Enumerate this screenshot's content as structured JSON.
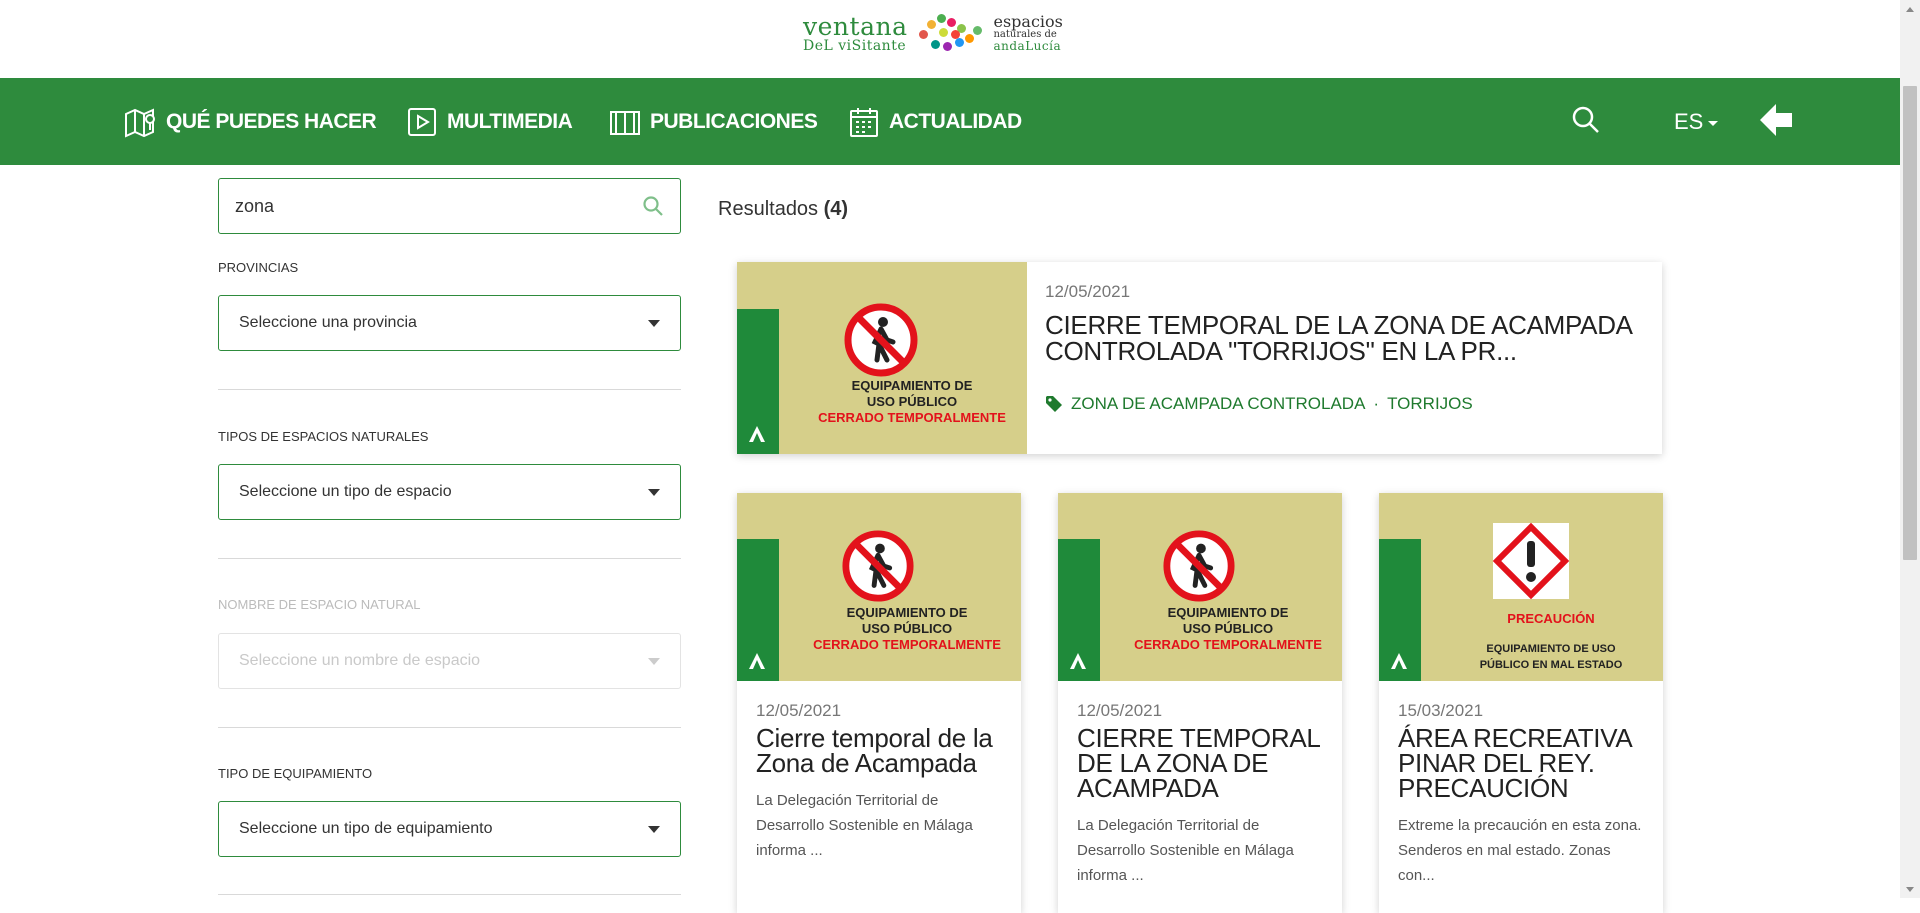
{
  "header": {
    "logo": {
      "brand_line1": "ventana",
      "brand_line2": "DeL viSitante",
      "partner_line1": "espacios",
      "partner_line2": "naturales de",
      "partner_line3": "andaLucía"
    },
    "nav": [
      {
        "label": "QUÉ PUEDES HACER",
        "icon": "map-pin-icon"
      },
      {
        "label": "MULTIMEDIA",
        "icon": "play-icon"
      },
      {
        "label": "PUBLICACIONES",
        "icon": "book-icon"
      },
      {
        "label": "ACTUALIDAD",
        "icon": "calendar-icon"
      }
    ],
    "language": "ES"
  },
  "sidebar": {
    "search": {
      "value": "zona"
    },
    "filters": [
      {
        "label": "PROVINCIAS",
        "selected": "Seleccione una provincia",
        "disabled": false
      },
      {
        "label": "TIPOS DE ESPACIOS NATURALES",
        "selected": "Seleccione un tipo de espacio",
        "disabled": false
      },
      {
        "label": "NOMBRE DE ESPACIO NATURAL",
        "selected": "Seleccione un nombre de espacio",
        "disabled": true
      },
      {
        "label": "TIPO DE EQUIPAMIENTO",
        "selected": "Seleccione un tipo de equipamiento",
        "disabled": false
      }
    ]
  },
  "results": {
    "label": "Resultados",
    "count": "(4)",
    "featured": {
      "date": "12/05/2021",
      "title": "CIERRE TEMPORAL DE LA ZONA DE ACAMPADA CONTROLADA \"TORRIJOS\" EN LA PR...",
      "tags": [
        "ZONA DE ACAMPADA CONTROLADA",
        "TORRIJOS"
      ],
      "tag_separator": "·",
      "thumb": {
        "line1": "EQUIPAMIENTO DE",
        "line2": "USO PÚBLICO",
        "line3": "CERRADO TEMPORALMENTE"
      }
    },
    "cards": [
      {
        "date": "12/05/2021",
        "title": "Cierre temporal de la Zona de Acampada",
        "excerpt": "La Delegación Territorial de Desarrollo Sostenible en Málaga informa ...",
        "thumb": {
          "line1": "EQUIPAMIENTO DE",
          "line2": "USO PÚBLICO",
          "line3": "CERRADO TEMPORALMENTE"
        }
      },
      {
        "date": "12/05/2021",
        "title": "CIERRE TEMPORAL DE LA ZONA DE ACAMPADA",
        "excerpt": "La Delegación Territorial de Desarrollo Sostenible en Málaga informa ...",
        "thumb": {
          "line1": "EQUIPAMIENTO DE",
          "line2": "USO PÚBLICO",
          "line3": "CERRADO TEMPORALMENTE"
        }
      },
      {
        "date": "15/03/2021",
        "title": "ÁREA RECREATIVA PINAR DEL REY. PRECAUCIÓN",
        "excerpt": "Extreme la precaución en esta zona. Senderos en mal estado. Zonas con...",
        "thumb": {
          "line1": "PRECAUCIÓN",
          "line2": "EQUIPAMIENTO DE USO",
          "line3": "PÚBLICO EN MAL ESTADO"
        }
      }
    ]
  },
  "colors": {
    "brand_green": "#2e8b3d",
    "thumb_bg": "#d6cf8a",
    "warning_red": "#e3121b"
  }
}
